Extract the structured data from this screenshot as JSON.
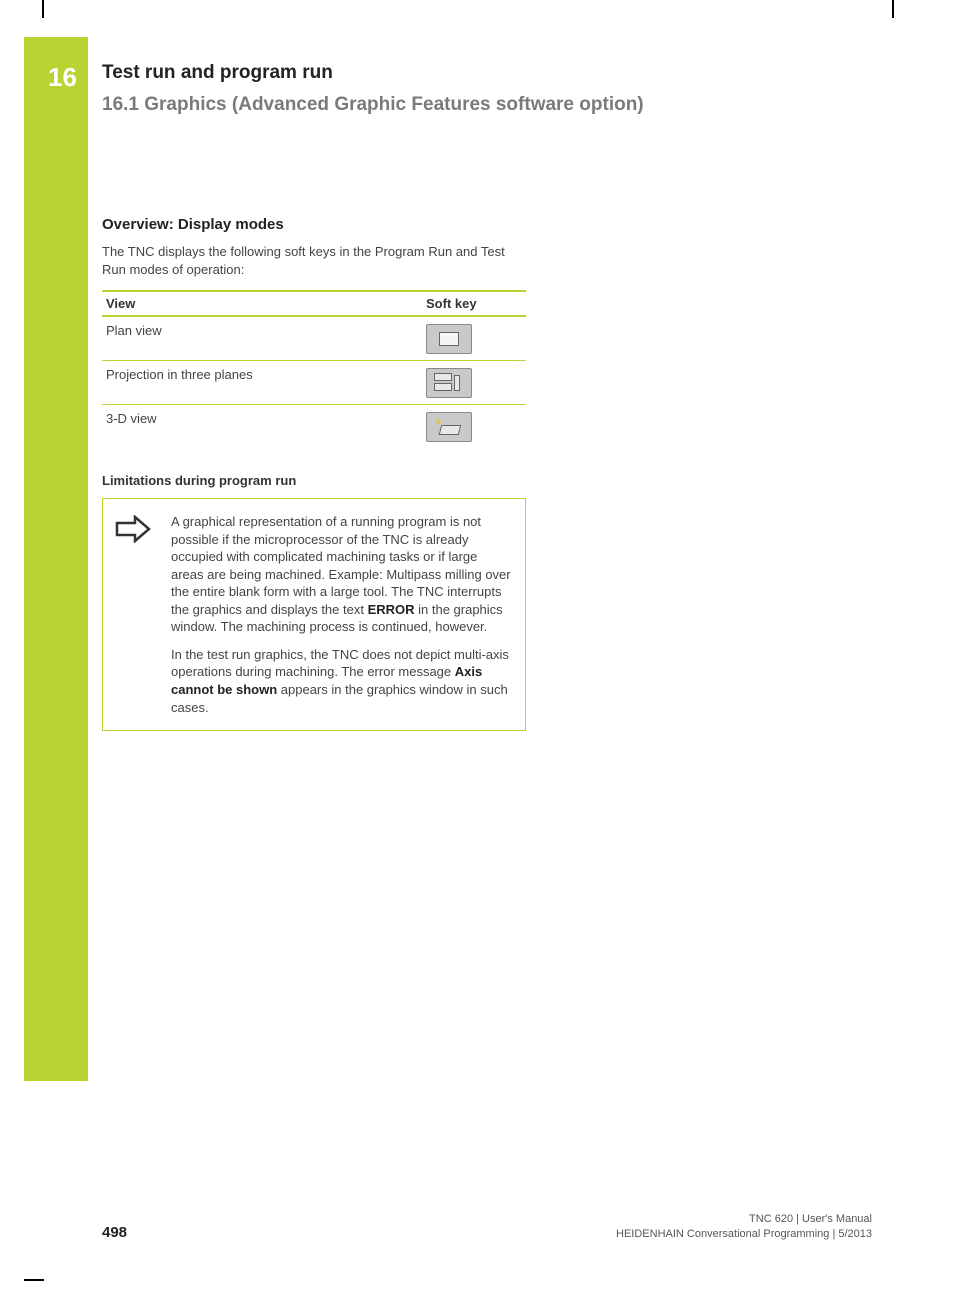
{
  "chapter": {
    "number": "16",
    "title": "Test run and program run",
    "section": "16.1   Graphics (Advanced Graphic Features software option)"
  },
  "overview": {
    "heading": "Overview: Display modes",
    "intro": "The TNC displays the following soft keys in the Program Run and Test Run modes of operation:",
    "table": {
      "head_view": "View",
      "head_key": "Soft key",
      "rows": [
        {
          "label": "Plan view",
          "icon": "plan-view-icon"
        },
        {
          "label": "Projection in three planes",
          "icon": "three-planes-icon"
        },
        {
          "label": "3-D view",
          "icon": "3d-view-icon"
        }
      ]
    }
  },
  "limitations": {
    "heading": "Limitations during program run",
    "para1_a": "A graphical representation of a running program is not possible if the microprocessor of the TNC is already occupied with complicated machining tasks or if large areas are being machined. Example: Multipass milling over the entire blank form with a large tool. The TNC interrupts the graphics and displays the text ",
    "para1_bold": "ERROR",
    "para1_b": " in the graphics window. The machining process is continued, however.",
    "para2_a": "In the test run graphics, the TNC does not depict multi-axis operations during machining. The error message ",
    "para2_bold": "Axis cannot be shown",
    "para2_b": " appears in the graphics window in such cases."
  },
  "footer": {
    "page": "498",
    "line1": "TNC 620 | User's Manual",
    "line2": "HEIDENHAIN Conversational Programming | 5/2013"
  }
}
